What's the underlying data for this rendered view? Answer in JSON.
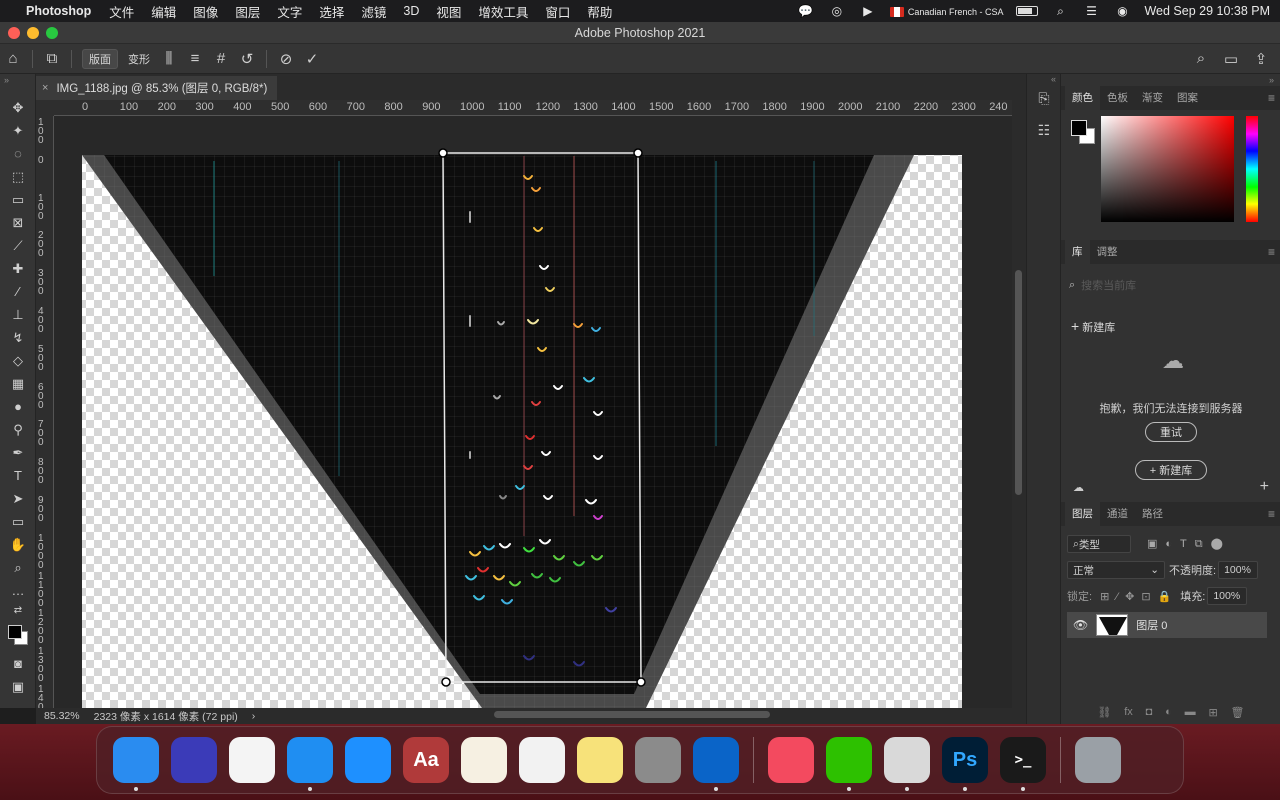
{
  "menubar": {
    "app_name": "Photoshop",
    "items": [
      "文件",
      "编辑",
      "图像",
      "图层",
      "文字",
      "选择",
      "滤镜",
      "3D",
      "视图",
      "增效工具",
      "窗口",
      "帮助"
    ],
    "input_source": "Canadian French - CSA",
    "clock": "Wed Sep 29  10:38 PM"
  },
  "window": {
    "title": "Adobe Photoshop 2021"
  },
  "options": {
    "mode1": "版面",
    "mode2": "变形"
  },
  "document": {
    "tab_label": "IMG_1188.jpg @ 85.3% (图层 0, RGB/8*)",
    "close_glyph": "×"
  },
  "ruler": {
    "h_labels": [
      "0",
      "100",
      "200",
      "300",
      "400",
      "500",
      "600",
      "700",
      "800",
      "900",
      "1000",
      "1100",
      "1200",
      "1300",
      "1400",
      "1500",
      "1600",
      "1700",
      "1800",
      "1900",
      "2000",
      "2100",
      "2200",
      "2300",
      "240"
    ],
    "v_labels": [
      "100",
      "0",
      "100",
      "200",
      "300",
      "400",
      "500",
      "600",
      "700",
      "800",
      "900",
      "1000",
      "1100",
      "1200",
      "1300",
      "1400"
    ]
  },
  "status": {
    "zoom": "85.32%",
    "doc_info": "2323 像素 x 1614 像素 (72 ppi)",
    "arrow": "›"
  },
  "color_panel": {
    "tabs": [
      "颜色",
      "色板",
      "渐变",
      "图案"
    ]
  },
  "library_panel": {
    "tabs": [
      "库",
      "调整"
    ],
    "search_placeholder": "搜索当前库",
    "new_library": "新建库",
    "error_message": "抱歉，我们无法连接到服务器",
    "retry_button": "重试",
    "new_library_button": "+ 新建库"
  },
  "layers_panel": {
    "tabs": [
      "图层",
      "通道",
      "路径"
    ],
    "filter_label": "类型",
    "blend_mode": "正常",
    "opacity_label": "不透明度:",
    "opacity_value": "100%",
    "lock_label": "锁定:",
    "fill_label": "填充:",
    "fill_value": "100%",
    "layer_name": "图层 0"
  },
  "dock": {
    "apps": [
      {
        "name": "Finder",
        "color": "#2a8cf0",
        "dot": true
      },
      {
        "name": "Siri",
        "color": "#3b3bb8",
        "dot": false
      },
      {
        "name": "Photos",
        "color": "#f4f4f4",
        "dot": false
      },
      {
        "name": "Safari",
        "color": "#1f8ef2",
        "dot": true
      },
      {
        "name": "Mail",
        "color": "#1e90ff",
        "dot": false
      },
      {
        "name": "Dictionary",
        "color": "#b03a3a",
        "dot": false,
        "glyph": "Aa"
      },
      {
        "name": "Pages",
        "color": "#f6f0e2",
        "dot": false
      },
      {
        "name": "Keynote",
        "color": "#f2f2f2",
        "dot": false
      },
      {
        "name": "Notes",
        "color": "#f7e27a",
        "dot": false
      },
      {
        "name": "System Preferences",
        "color": "#8b8b8b",
        "dot": false
      },
      {
        "name": "Outlook",
        "color": "#0a64c8",
        "dot": true
      },
      {
        "name": "Music",
        "color": "#f34a5f",
        "dot": false
      },
      {
        "name": "WeChat",
        "color": "#2dc100",
        "dot": true
      },
      {
        "name": "Script Editor",
        "color": "#d9d9d9",
        "dot": true
      },
      {
        "name": "Photoshop",
        "color": "#001e36",
        "dot": true,
        "glyph": "Ps"
      },
      {
        "name": "Terminal",
        "color": "#1a1a1a",
        "dot": true,
        "glyph": ">_"
      },
      {
        "name": "Trash",
        "color": "#9aa0a6",
        "dot": false
      }
    ]
  },
  "colors": {
    "accent_blue": "#31a8ff",
    "panel_bg": "#323232",
    "canvas_bg": "#282828"
  }
}
